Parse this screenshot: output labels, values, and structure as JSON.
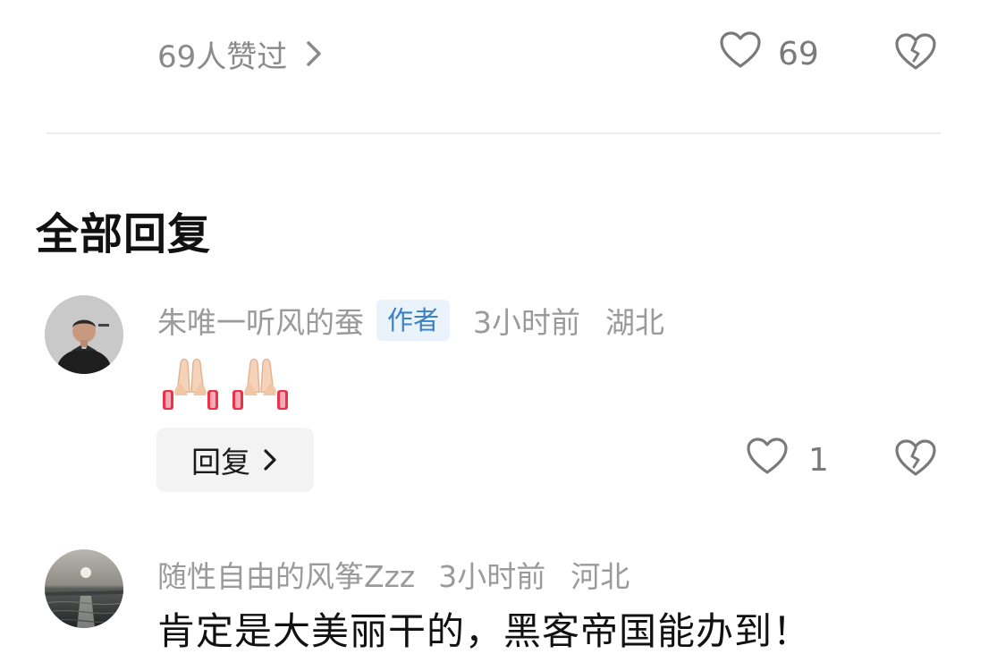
{
  "likes_bar": {
    "likers_text": "69人赞过",
    "like_count": "69"
  },
  "section": {
    "title": "全部回复"
  },
  "comments": [
    {
      "username": "朱唯一听风的蚕",
      "badge": "作者",
      "time": "3小时前",
      "location": "湖北",
      "content_emoji": [
        "🙏",
        "🙏"
      ],
      "reply_label": "回复",
      "like_count": "1"
    },
    {
      "username": "随性自由的风筝Zzz",
      "time": "3小时前",
      "location": "河北",
      "content": "肯定是大美丽干的，黑客帝国能办到！"
    }
  ],
  "colors": {
    "muted_text": "#9a9a9a",
    "badge_bg": "#eaf3fb",
    "badge_text": "#3b7fc4",
    "reply_bg": "#f3f3f3",
    "divider": "#ececec"
  }
}
